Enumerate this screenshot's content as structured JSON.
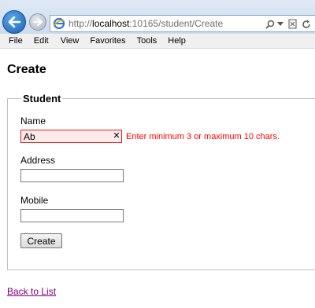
{
  "browser": {
    "address_prefix": "http://",
    "address_host": "localhost",
    "address_rest": ":10165/student/Create",
    "back_icon": "back-arrow-icon",
    "forward_icon": "forward-arrow-icon",
    "page_icon": "ie-page-icon",
    "search_icon": "search-icon",
    "dropdown_icon": "chevron-down-icon",
    "compat_icon": "compatibility-view-icon",
    "refresh_icon": "refresh-icon"
  },
  "menu": {
    "items": [
      {
        "label": "File"
      },
      {
        "label": "Edit"
      },
      {
        "label": "View"
      },
      {
        "label": "Favorites"
      },
      {
        "label": "Tools"
      },
      {
        "label": "Help"
      }
    ]
  },
  "page": {
    "title": "Create",
    "legend": "Student",
    "fields": [
      {
        "label": "Name",
        "value": "Ab",
        "error": "Enter minimum 3 or maximum 10 chars."
      },
      {
        "label": "Address",
        "value": ""
      },
      {
        "label": "Mobile",
        "value": ""
      }
    ],
    "submit_label": "Create",
    "back_link": "Back to List"
  },
  "colors": {
    "error": "#ff0000",
    "error_bg": "#ffeaea",
    "visited_link": "#800080"
  }
}
